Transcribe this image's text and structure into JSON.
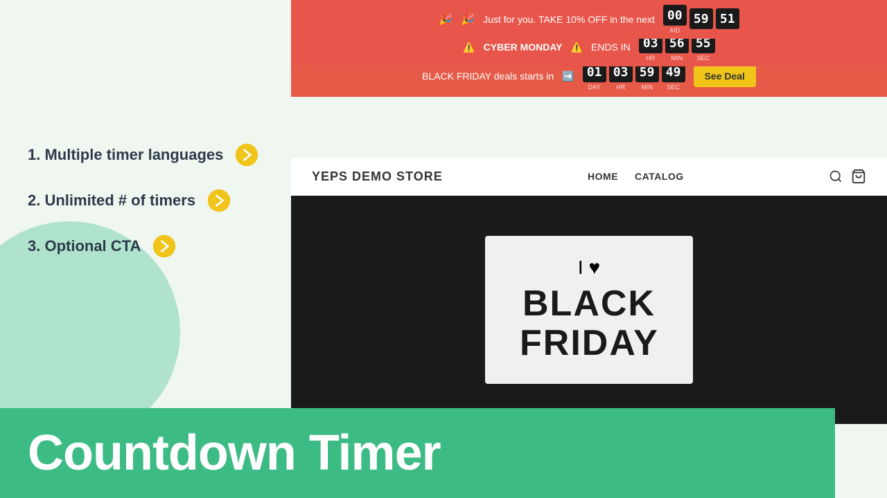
{
  "left_panel": {
    "features": [
      {
        "id": 1,
        "text": "1. Multiple timer languages"
      },
      {
        "id": 2,
        "text": "2. Unlimited # of timers"
      },
      {
        "id": 3,
        "text": "3. Optional CTA"
      }
    ]
  },
  "bottom_bar": {
    "label": "Countdown Timer"
  },
  "banners": [
    {
      "id": "banner1",
      "emoji_left": "🎉",
      "emoji_right": "🎉",
      "text": "Just for you. TAKE 10% OFF in the next",
      "digits": [
        {
          "value": "00",
          "label": "AID"
        },
        {
          "value": "59",
          "label": ""
        },
        {
          "value": "51",
          "label": ""
        }
      ]
    },
    {
      "id": "banner2",
      "emoji_left": "⚠️",
      "text": "CYBER MONDAY",
      "emoji_right": "⚠️",
      "suffix": "ENDS IN",
      "digits": [
        {
          "value": "03",
          "label": "HR"
        },
        {
          "value": "56",
          "label": "MIN"
        },
        {
          "value": "55",
          "label": "SEC"
        }
      ]
    },
    {
      "id": "banner3",
      "text": "BLACK FRIDAY deals starts in",
      "emoji_arrow": "➡️",
      "digits": [
        {
          "value": "01",
          "label": "DAY"
        },
        {
          "value": "03",
          "label": "HR"
        },
        {
          "value": "59",
          "label": "MIN"
        },
        {
          "value": "49",
          "label": "SEC"
        }
      ],
      "cta": "See Deal"
    }
  ],
  "store": {
    "logo": "YEPS DEMO STORE",
    "nav_links": [
      "HOME",
      "CATALOG"
    ],
    "icons": [
      "search",
      "cart"
    ]
  },
  "hero": {
    "line1": "I ♥",
    "line2": "BLACK",
    "line3": "FRIDAY"
  },
  "colors": {
    "banner_bg": "#e8554a",
    "bottom_bar": "#3dbb85",
    "left_bg": "#f0f7f0",
    "digit_bg": "#1a1a1a",
    "cta_bg": "#f0c419"
  }
}
